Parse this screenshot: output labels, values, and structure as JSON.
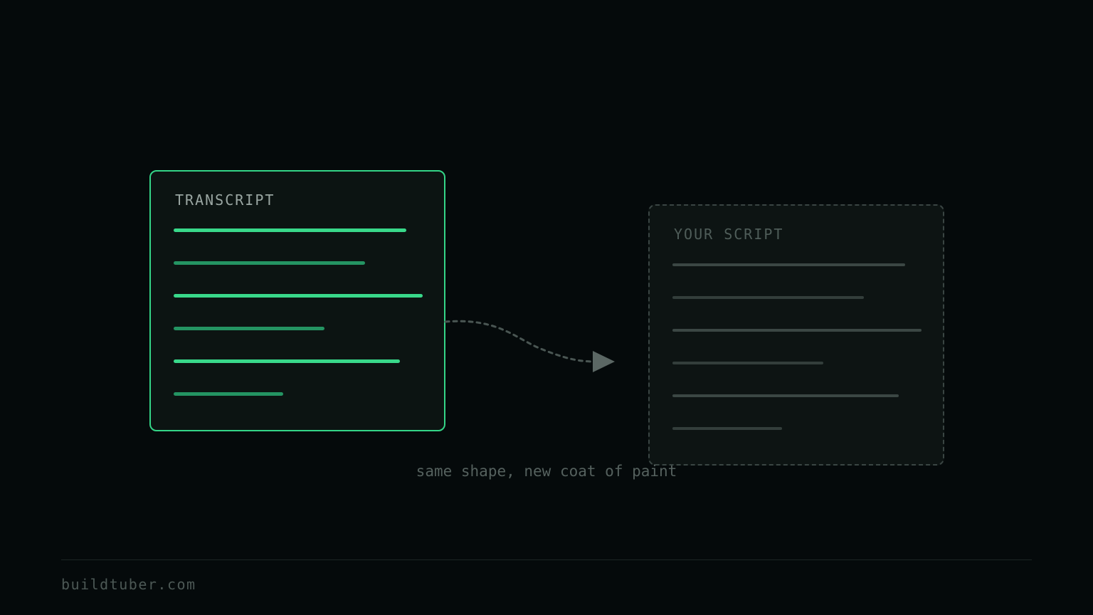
{
  "diagram": {
    "source_card": {
      "title": "TRANSCRIPT"
    },
    "target_card": {
      "title": "YOUR SCRIPT"
    },
    "caption": "same shape, new coat of paint"
  },
  "footer": {
    "site": "buildtuber.com"
  },
  "colors": {
    "background": "#050a0b",
    "accent": "#39d98a",
    "accent_dim": "#249462",
    "muted": "#3b4744"
  }
}
